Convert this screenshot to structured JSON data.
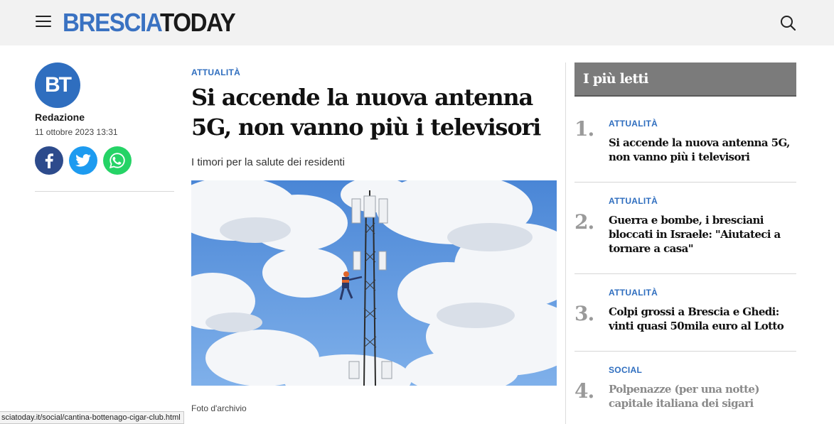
{
  "header": {
    "logo_part1": "BRESCIA",
    "logo_part2": "TODAY",
    "menu_icon": "hamburger-menu-icon",
    "search_icon": "search-icon",
    "logo_blue": "#3a72c2"
  },
  "author": {
    "initials": "BT",
    "name": "Redazione",
    "date": "11 ottobre 2023 13:31",
    "share": {
      "facebook_icon": "facebook-icon",
      "twitter_icon": "twitter-icon",
      "whatsapp_icon": "whatsapp-icon"
    }
  },
  "article": {
    "category": "ATTUALITÀ",
    "headline": "Si accende la nuova antenna 5G, non vanno più i televisori",
    "subtitle": "I timori per la salute dei residenti",
    "image_caption": "Foto d'archivio"
  },
  "sidebar": {
    "title": "I più letti",
    "items": [
      {
        "number": "1.",
        "category": "ATTUALITÀ",
        "title": "Si accende la nuova antenna 5G, non vanno più i televisori"
      },
      {
        "number": "2.",
        "category": "ATTUALITÀ",
        "title": "Guerra e bombe, i bresciani bloccati in Israele: \"Aiutateci a tornare a casa\""
      },
      {
        "number": "3.",
        "category": "ATTUALITÀ",
        "title": "Colpi grossi a Brescia e Ghedi: vinti quasi 50mila euro al Lotto"
      },
      {
        "number": "4.",
        "category": "SOCIAL",
        "title": "Polpenazze (per una notte) capitale italiana dei sigari"
      }
    ]
  },
  "statusbar": {
    "url": "sciatoday.it/social/cantina-bottenago-cigar-club.html"
  },
  "colors": {
    "accent_blue": "#2f6ebf",
    "sidebar_header_bg": "#7b7b7b",
    "facebook": "#2d4b8c",
    "twitter": "#1d9bf0",
    "whatsapp": "#25d366"
  }
}
